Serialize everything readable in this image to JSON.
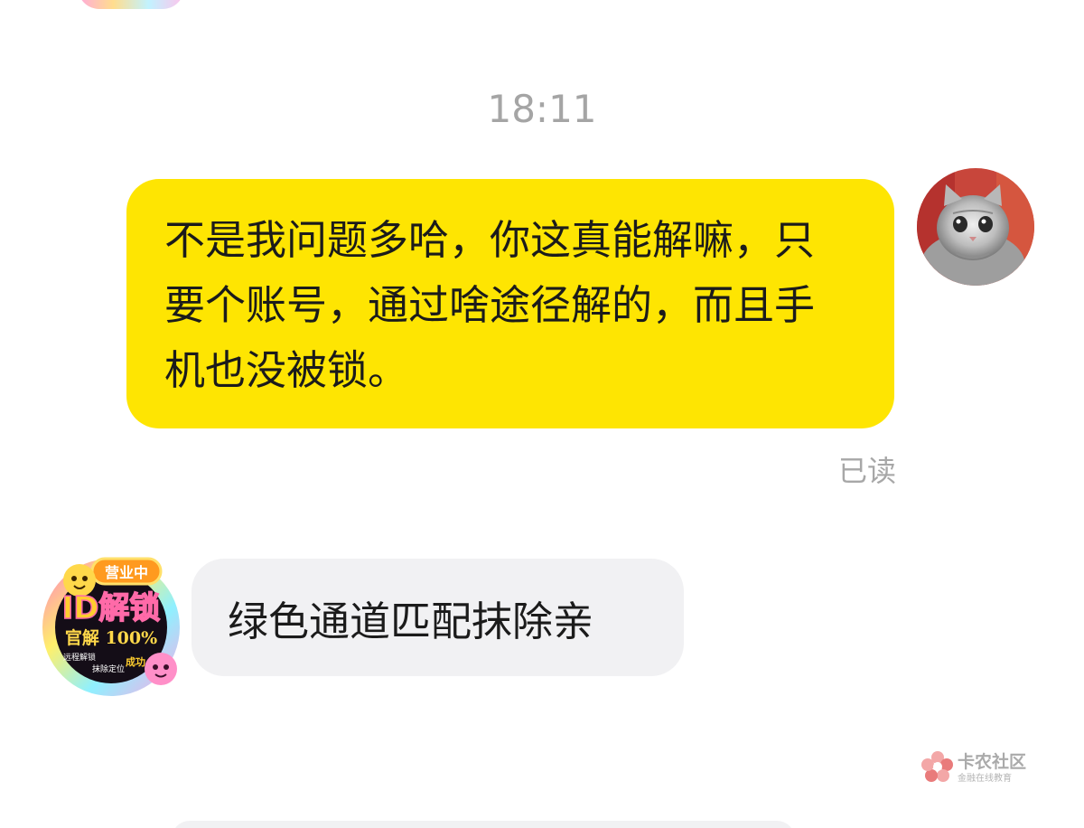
{
  "chat": {
    "timestamp": "18:11",
    "messages": [
      {
        "sender": "me",
        "text": "不是我问题多哈，你这真能解嘛，只要个账号，通过啥途径解的，而且手机也没被锁。",
        "status": "已读",
        "bubble_color": "#fee502"
      },
      {
        "sender": "other",
        "text": "绿色通道匹配抹除亲",
        "bubble_color": "#f1f1f3"
      }
    ],
    "other_avatar": {
      "badge": "营业中",
      "headline": "ID解锁",
      "subline": "官解 100%",
      "note_left": "远程解锁",
      "note_right": "抹除定位",
      "note_corner": "成功"
    }
  },
  "watermark": {
    "title": "卡农社区",
    "subtitle": "金融在线教育"
  },
  "icons": {
    "avatar_right": "cat-photo-avatar",
    "watermark_logo": "flower-logo-icon"
  }
}
